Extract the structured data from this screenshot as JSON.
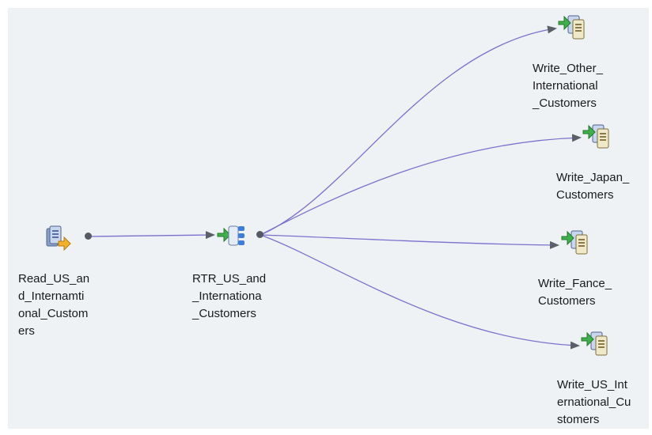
{
  "canvas": {
    "background": "#eef2f5",
    "link_color": "#7d6fcc",
    "port_color": "#555a63"
  },
  "nodes": {
    "read": {
      "icon": "read-source-icon",
      "label": "Read_US_an\nd_Internamti\nonal_Custom\ners"
    },
    "router": {
      "icon": "router-transformation-icon",
      "label": "RTR_US_and\n_Internationa\n_Customers"
    },
    "write_other": {
      "icon": "write-target-icon",
      "label": "Write_Other_\nInternational\n_Customers"
    },
    "write_japan": {
      "icon": "write-target-icon",
      "label": "Write_Japan_\nCustomers"
    },
    "write_fance": {
      "icon": "write-target-icon",
      "label": "Write_Fance_\nCustomers"
    },
    "write_us": {
      "icon": "write-target-icon",
      "label": "Write_US_Int\nernational_Cu\nstomers"
    }
  }
}
